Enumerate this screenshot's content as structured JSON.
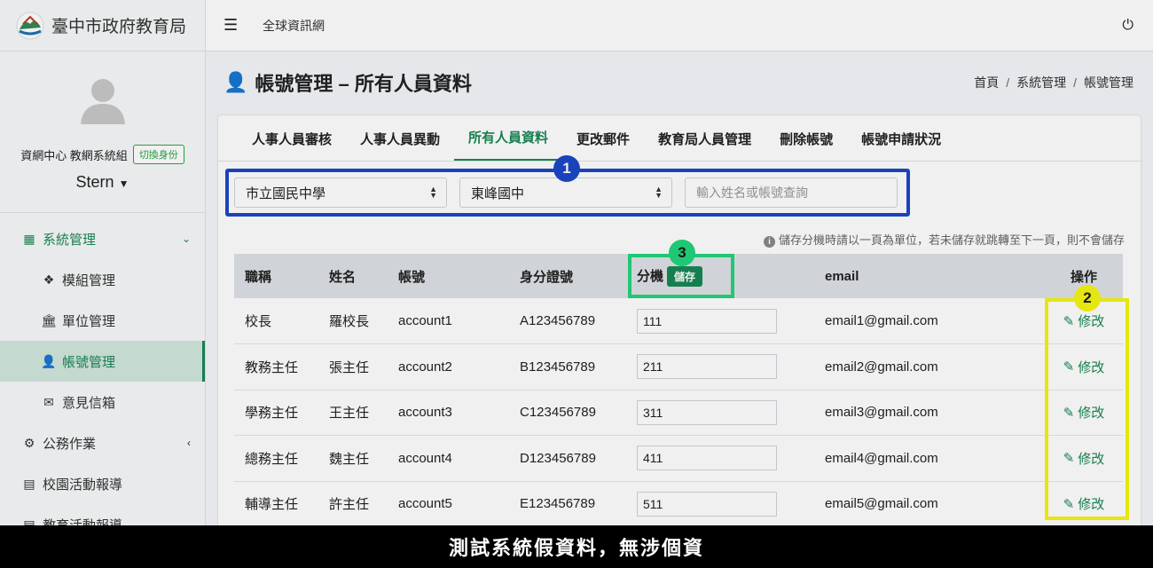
{
  "brand": {
    "title": "臺中市政府教育局",
    "logo_icon": "city-logo-icon"
  },
  "user": {
    "unit": "資網中心 教網系統組",
    "switch_label": "切換身份",
    "name": "Stern"
  },
  "sidebar": {
    "items": [
      {
        "label": "系統管理",
        "icon": "grid-icon"
      },
      {
        "label": "模組管理",
        "icon": "cubes-icon"
      },
      {
        "label": "單位管理",
        "icon": "bank-icon"
      },
      {
        "label": "帳號管理",
        "icon": "user-icon"
      },
      {
        "label": "意見信箱",
        "icon": "envelope-open-icon"
      },
      {
        "label": "公務作業",
        "icon": "gears-icon"
      },
      {
        "label": "校園活動報導",
        "icon": "newspaper-icon"
      },
      {
        "label": "教育活動報導",
        "icon": "newspaper-icon"
      }
    ]
  },
  "topbar": {
    "link": "全球資訊網"
  },
  "header": {
    "title": "帳號管理 – 所有人員資料",
    "breadcrumb": [
      "首頁",
      "系統管理",
      "帳號管理"
    ]
  },
  "tabs": [
    "人事人員審核",
    "人事人員異動",
    "所有人員資料",
    "更改郵件",
    "教育局人員管理",
    "刪除帳號",
    "帳號申請狀況"
  ],
  "filters": {
    "select1": "市立國民中學",
    "select2": "東峰國中",
    "search_placeholder": "輸入姓名或帳號查詢"
  },
  "notice": "儲存分機時請以一頁為單位，若未儲存就跳轉至下一頁，則不會儲存",
  "table": {
    "headers": {
      "title": "職稱",
      "name": "姓名",
      "account": "帳號",
      "id": "身分證號",
      "ext": "分機",
      "save": "儲存",
      "email": "email",
      "action": "操作"
    },
    "edit_label": "修改",
    "rows": [
      {
        "title": "校長",
        "name": "羅校長",
        "account": "account1",
        "id": "A123456789",
        "ext": "111",
        "email": "email1@gmail.com"
      },
      {
        "title": "教務主任",
        "name": "張主任",
        "account": "account2",
        "id": "B123456789",
        "ext": "211",
        "email": "email2@gmail.com"
      },
      {
        "title": "學務主任",
        "name": "王主任",
        "account": "account3",
        "id": "C123456789",
        "ext": "311",
        "email": "email3@gmail.com"
      },
      {
        "title": "總務主任",
        "name": "魏主任",
        "account": "account4",
        "id": "D123456789",
        "ext": "411",
        "email": "email4@gmail.com"
      },
      {
        "title": "輔導主任",
        "name": "許主任",
        "account": "account5",
        "id": "E123456789",
        "ext": "511",
        "email": "email5@gmail.com"
      }
    ]
  },
  "markers": {
    "m1": "1",
    "m2": "2",
    "m3": "3"
  },
  "banner": "測試系統假資料，無涉個資",
  "colors": {
    "accent": "#198754",
    "marker_blue": "#1c48c7",
    "marker_green": "#22d47c",
    "marker_yellow": "#f5f511"
  }
}
